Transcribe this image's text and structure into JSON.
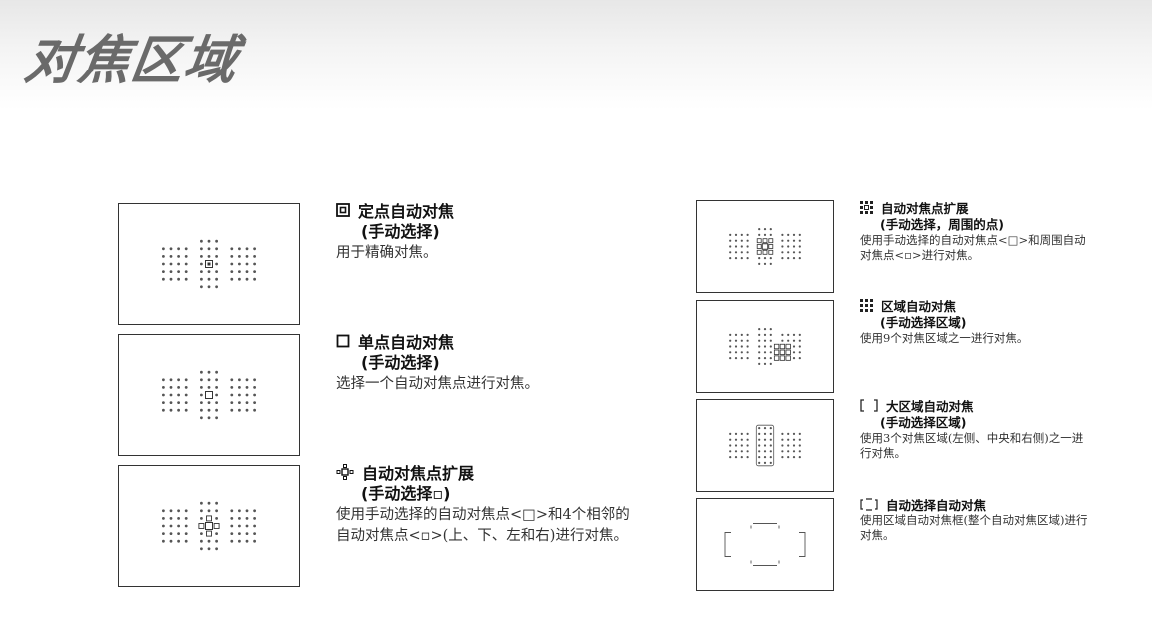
{
  "page": {
    "title": "对焦区域"
  },
  "modes_left": [
    {
      "icon": "spot-af-icon",
      "title": "定点自动对焦",
      "sub": "(手动选择)",
      "desc": "用于精确对焦。"
    },
    {
      "icon": "single-point-af-icon",
      "title": "单点自动对焦",
      "sub": "(手动选择)",
      "desc": "选择一个自动对焦点进行对焦。"
    },
    {
      "icon": "af-point-expansion-icon",
      "title": "自动对焦点扩展",
      "sub": "(手动选择▫)",
      "desc": "使用手动选择的自动对焦点<□>和4个相邻的自动对焦点<▫>(上、下、左和右)进行对焦。"
    }
  ],
  "modes_right": [
    {
      "icon": "af-point-expansion-surround-icon",
      "title": "自动对焦点扩展",
      "sub": "(手动选择，周围的点)",
      "desc": "使用手动选择的自动对焦点<□>和周围自动对焦点<▫>进行对焦。"
    },
    {
      "icon": "zone-af-icon",
      "title": "区域自动对焦",
      "sub": "(手动选择区域)",
      "desc": "使用9个对焦区域之一进行对焦。"
    },
    {
      "icon": "large-zone-af-icon",
      "title": "大区域自动对焦",
      "sub": "(手动选择区域)",
      "desc": "使用3个对焦区域(左侧、中央和右侧)之一进行对焦。"
    },
    {
      "icon": "auto-selection-af-icon",
      "title": "自动选择自动对焦",
      "sub": "",
      "desc": "使用区域自动对焦框(整个自动对焦区域)进行对焦。"
    }
  ]
}
